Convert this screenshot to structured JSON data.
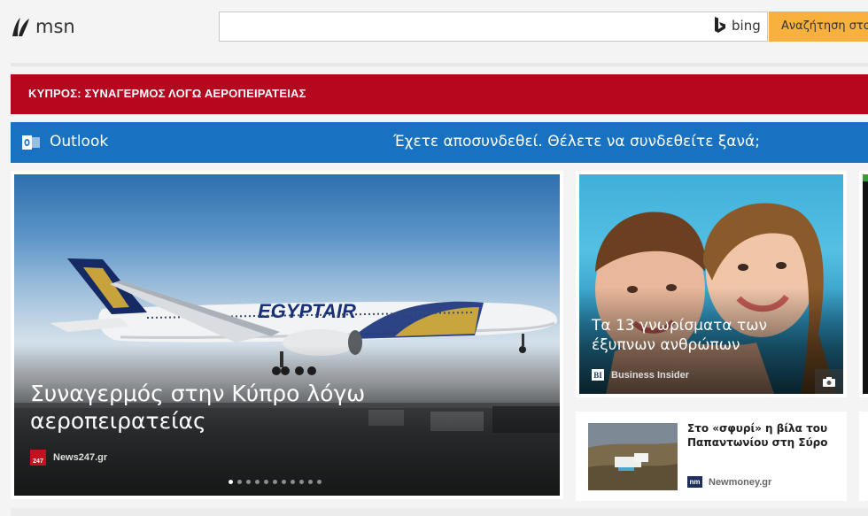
{
  "header": {
    "logo_text": "msn",
    "search": {
      "value": "",
      "placeholder": ""
    },
    "bing_label": "bing",
    "search_button_label": "Αναζήτηση στο Web"
  },
  "breaking": {
    "text": "ΚΥΠΡΟΣ: ΣΥΝΑΓΕΡΜΟΣ ΛΟΓΩ ΑΕΡΟΠΕΙΡΑΤΕΙΑΣ"
  },
  "outlook": {
    "label": "Outlook",
    "message": "Έχετε αποσυνδεθεί. Θέλετε να συνδεθείτε ξανά;"
  },
  "hero": {
    "title": "Συναγερμός στην Κύπρο λόγω αεροπειρατείας",
    "source": "News247.gr",
    "slide_count": 11,
    "active_slide": 0
  },
  "tiles": [
    {
      "title": "Τα 13 γνωρίσματα των έξυπνων ανθρώπων",
      "source": "Business Insider",
      "source_logo": "BI"
    },
    {
      "title": "Στο «σφυρί» η βίλα του Παπαντωνίου στη Σύρο",
      "source": "Newmoney.gr",
      "source_logo": "nm"
    }
  ],
  "colors": {
    "breaking_red": "#b5071e",
    "outlook_blue": "#1972c1",
    "search_orange": "#f7b13c"
  }
}
